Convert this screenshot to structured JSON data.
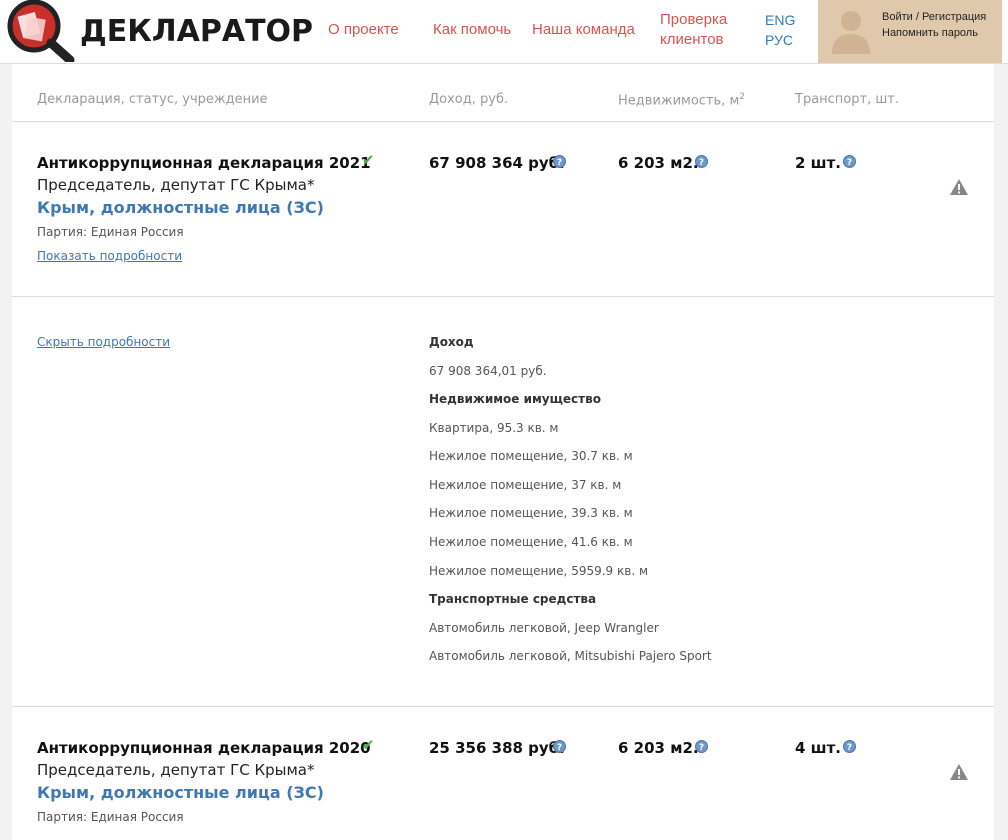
{
  "header": {
    "brand": "ДЕКЛАРАТОР",
    "nav": [
      "О проекте",
      "Как помочь",
      "Наша команда"
    ],
    "nav_check": [
      "Проверка",
      "клиентов"
    ],
    "lang": [
      "ENG",
      "РУС"
    ],
    "user": {
      "login": "Войти / Регистрация",
      "remind": "Напомнить пароль"
    }
  },
  "columns": {
    "declaration": "Декларация, статус, учреждение",
    "income": "Доход, руб.",
    "realty": "Недвижимость, м",
    "realty_sup": "2",
    "transport": "Транспорт, шт."
  },
  "declarations": [
    {
      "title": "Антикоррупционная декларация 2021",
      "position": "Председатель, депутат ГС Крыма*",
      "region": "Крым, должностные лица (ЗС)",
      "party": "Партия: Единая Россия",
      "show_details": "Показать подробности",
      "income": "67 908 364 руб.",
      "realty": "6 203 м2.",
      "transport": "2 шт."
    },
    {
      "title": "Антикоррупционная декларация 2020",
      "position": "Председатель, депутат ГС Крыма*",
      "region": "Крым, должностные лица (ЗС)",
      "party": "Партия: Единая Россия",
      "income": "25 356 388 руб.",
      "realty": "6 203 м2.",
      "transport": "4 шт."
    }
  ],
  "details": {
    "hide": "Скрыть подробности",
    "income_header": "Доход",
    "income_value": "67 908 364,01 руб.",
    "realty_header": "Недвижимое имущество",
    "realty_items": [
      "Квартира, 95.3 кв. м",
      "Нежилое помещение, 30.7 кв. м",
      "Нежилое помещение, 37 кв. м",
      "Нежилое помещение, 39.3 кв. м",
      "Нежилое помещение, 41.6 кв. м",
      "Нежилое помещение, 5959.9 кв. м"
    ],
    "transport_header": "Транспортные средства",
    "transport_items": [
      "Автомобиль легковой, Jeep Wrangler",
      "Автомобиль легковой, Mitsubishi Pajero Sport"
    ]
  },
  "colors": {
    "nav": "#d9534f",
    "link": "#3f78b3",
    "check": "#4cae4c",
    "userbox": "#dfc8ab"
  }
}
